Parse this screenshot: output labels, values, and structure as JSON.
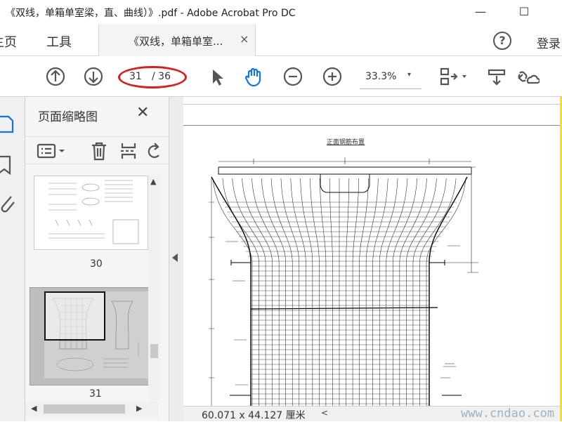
{
  "window": {
    "title": "《双线，单箱单室梁，直、曲线）》.pdf - Adobe Acrobat Pro DC",
    "minimize": "—",
    "maximize": "☐"
  },
  "tabs": {
    "home": "主页",
    "tools": "工具",
    "document": "《双线，单箱单室...",
    "close": "×",
    "help": "?",
    "login": "登录"
  },
  "toolbar": {
    "page_current": "31",
    "page_total": "/ 36",
    "zoom": "33.3%",
    "zoom_caret": "▾"
  },
  "thumbnails": {
    "title": "页面缩略图",
    "close": "✕",
    "pages": [
      {
        "label": "30",
        "selected": false
      },
      {
        "label": "31",
        "selected": true
      }
    ]
  },
  "document": {
    "drawing_title": "正面钢筋布置"
  },
  "status": {
    "page_size": "60.071 x 44.127 厘米",
    "watermark": "www.cndao.com"
  },
  "colors": {
    "highlight_oval": "#d42020",
    "hand_tool_active": "#1473e6",
    "frame_border": "#f5e11f"
  },
  "icons": [
    "previous-page-icon",
    "next-page-icon",
    "select-arrow-icon",
    "hand-tool-icon",
    "zoom-out-icon",
    "zoom-in-icon",
    "page-fit-icon",
    "scroll-mode-icon",
    "share-link-icon",
    "file-icon",
    "bookmark-icon",
    "attachment-icon",
    "options-icon",
    "delete-icon",
    "insert-page-icon",
    "rotate-icon"
  ]
}
